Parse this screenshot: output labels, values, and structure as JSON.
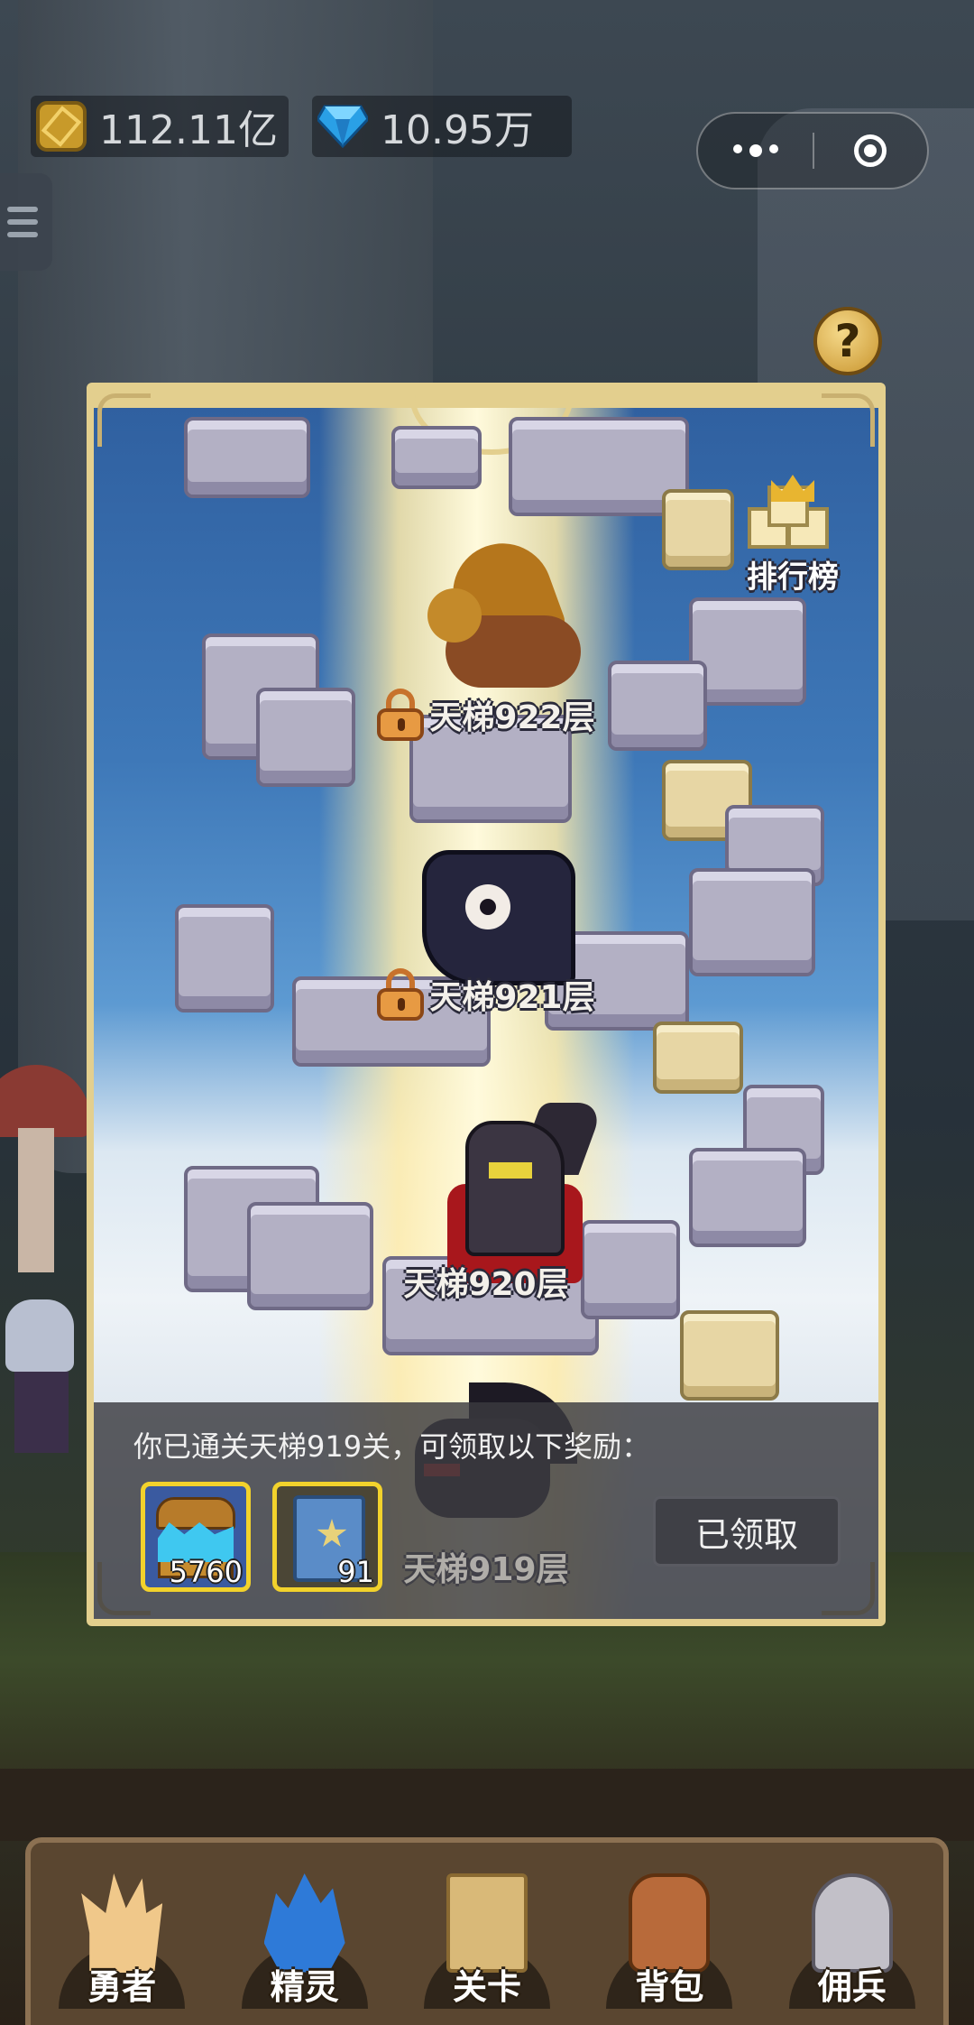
{
  "currencies": {
    "gold": {
      "icon": "gold-coin-icon",
      "value": "112.11亿"
    },
    "diamond": {
      "icon": "diamond-icon",
      "value": "10.95万"
    }
  },
  "help": {
    "label": "?"
  },
  "ladder": {
    "rank_label": "排行榜",
    "floors": [
      {
        "label": "天梯922层",
        "locked": true,
        "monster": "griffin"
      },
      {
        "label": "天梯921层",
        "locked": true,
        "monster": "shadow-ghost"
      },
      {
        "label": "天梯920层",
        "locked": false,
        "monster": "dark-knight"
      },
      {
        "label": "天梯919层",
        "locked": false,
        "monster": "black-dragon"
      }
    ]
  },
  "reward": {
    "message": "你已通关天梯919关，可领取以下奖励：",
    "items": [
      {
        "icon": "diamond-chest-icon",
        "count": "5760"
      },
      {
        "icon": "skill-book-icon",
        "count": "91"
      }
    ],
    "claimed_label": "已领取"
  },
  "nav": {
    "items": [
      {
        "label": "勇者",
        "icon": "hero-icon"
      },
      {
        "label": "精灵",
        "icon": "spirit-icon"
      },
      {
        "label": "关卡",
        "icon": "stage-map-icon"
      },
      {
        "label": "背包",
        "icon": "backpack-icon"
      },
      {
        "label": "佣兵",
        "icon": "mercenary-icon"
      }
    ]
  },
  "colors": {
    "panel_border": "#e3cf8e",
    "gold_accent": "#f2d22c",
    "nav_bg": "#5a4630"
  }
}
